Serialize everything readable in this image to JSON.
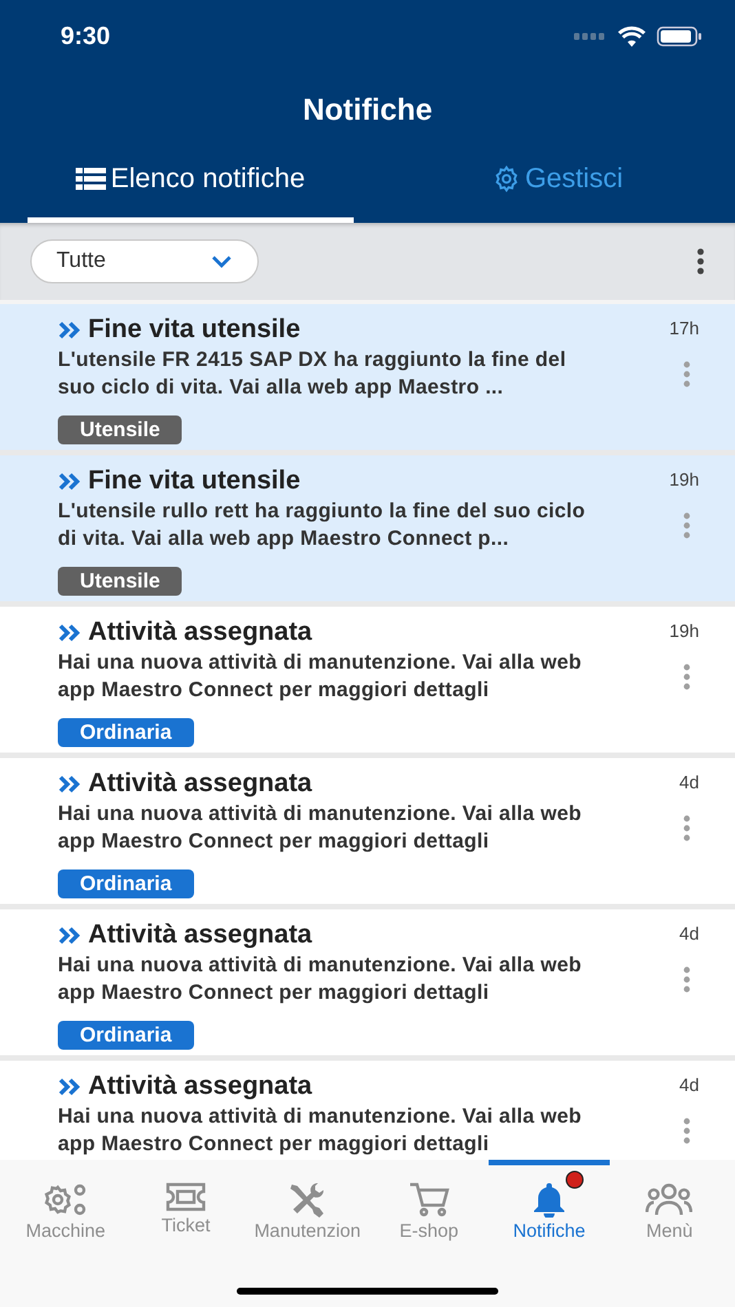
{
  "status_bar": {
    "time": "9:30"
  },
  "header": {
    "title": "Notifiche"
  },
  "tabs": [
    {
      "label": "Elenco notifiche",
      "selected": true
    },
    {
      "label": "Gestisci",
      "selected": false
    }
  ],
  "filter": {
    "value": "Tutte"
  },
  "notifications": [
    {
      "title": "Fine vita utensile",
      "message": "L'utensile FR 2415 SAP DX ha raggiunto la fine del suo ciclo di vita. Vai alla web app Maestro ...",
      "time": "17h",
      "tag": {
        "label": "Utensile",
        "color": "#616161"
      },
      "unread": true
    },
    {
      "title": "Fine vita utensile",
      "message": "L'utensile rullo rett ha raggiunto la fine del suo ciclo di vita. Vai alla web app Maestro Connect p...",
      "time": "19h",
      "tag": {
        "label": "Utensile",
        "color": "#616161"
      },
      "unread": true
    },
    {
      "title": "Attività assegnata",
      "message": "Hai una nuova attività di manutenzione. Vai alla web app Maestro Connect per maggiori dettagli",
      "time": "19h",
      "tag": {
        "label": "Ordinaria",
        "color": "#1a73d1"
      },
      "unread": false
    },
    {
      "title": "Attività assegnata",
      "message": "Hai una nuova attività di manutenzione. Vai alla web app Maestro Connect per maggiori dettagli",
      "time": "4d",
      "tag": {
        "label": "Ordinaria",
        "color": "#1a73d1"
      },
      "unread": false
    },
    {
      "title": "Attività assegnata",
      "message": "Hai una nuova attività di manutenzione. Vai alla web app Maestro Connect per maggiori dettagli",
      "time": "4d",
      "tag": {
        "label": "Ordinaria",
        "color": "#1a73d1"
      },
      "unread": false
    },
    {
      "title": "Attività assegnata",
      "message": "Hai una nuova attività di manutenzione. Vai alla web app Maestro Connect per maggiori dettagli",
      "time": "4d",
      "unread": false
    }
  ],
  "nav": [
    {
      "label": "Macchine",
      "selected": false,
      "badge": false
    },
    {
      "label": "Ticket",
      "selected": false,
      "badge": false
    },
    {
      "label": "Manutenzion",
      "selected": false,
      "badge": false
    },
    {
      "label": "E-shop",
      "selected": false,
      "badge": false
    },
    {
      "label": "Notifiche",
      "selected": true,
      "badge": true
    },
    {
      "label": "Menù",
      "selected": false,
      "badge": false
    }
  ]
}
